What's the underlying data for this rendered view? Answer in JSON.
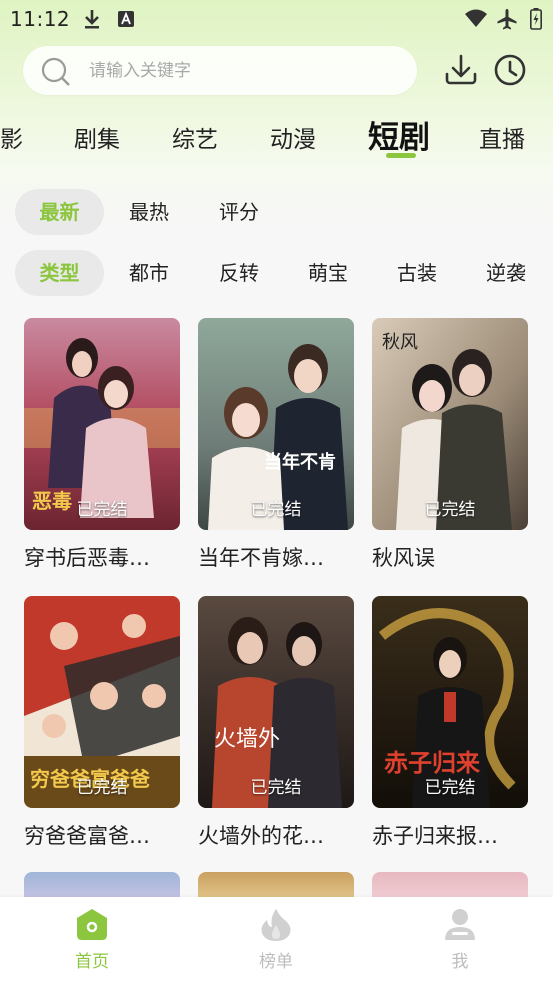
{
  "status": {
    "time": "11:12"
  },
  "search": {
    "placeholder": "请输入关键字"
  },
  "categories": [
    {
      "label": "影"
    },
    {
      "label": "剧集"
    },
    {
      "label": "综艺"
    },
    {
      "label": "动漫"
    },
    {
      "label": "短剧",
      "active": true
    },
    {
      "label": "直播"
    }
  ],
  "sort_filters": [
    {
      "label": "最新",
      "active": true
    },
    {
      "label": "最热"
    },
    {
      "label": "评分"
    }
  ],
  "type_filters": [
    {
      "label": "类型",
      "active": true
    },
    {
      "label": "都市"
    },
    {
      "label": "反转"
    },
    {
      "label": "萌宝"
    },
    {
      "label": "古装"
    },
    {
      "label": "逆袭"
    }
  ],
  "dramas": [
    {
      "title": "穿书后恶毒…",
      "badge": "已完结"
    },
    {
      "title": "当年不肯嫁…",
      "badge": "已完结"
    },
    {
      "title": "秋风误",
      "badge": "已完结"
    },
    {
      "title": "穷爸爸富爸…",
      "badge": "已完结"
    },
    {
      "title": "火墙外的花…",
      "badge": "已完结"
    },
    {
      "title": "赤子归来报…",
      "badge": "已完结"
    }
  ],
  "bottom_nav": [
    {
      "label": "首页",
      "active": true
    },
    {
      "label": "榜单"
    },
    {
      "label": "我"
    }
  ],
  "colors": {
    "accent": "#8cc63f",
    "inactive": "#bdbdbd"
  }
}
